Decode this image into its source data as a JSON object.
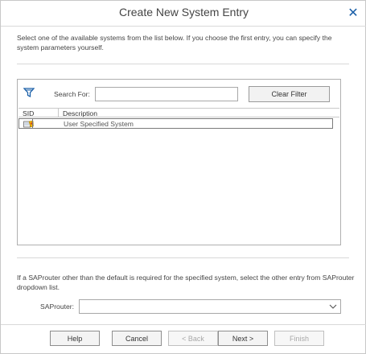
{
  "dialog": {
    "title": "Create New System Entry",
    "close_glyph": "✕"
  },
  "intro": {
    "text": "Select one of the available systems from the list below. If you choose the first entry, you can specify the system parameters yourself."
  },
  "filter": {
    "icon": "filter-icon",
    "search_label": "Search For:",
    "search_value": "",
    "clear_label": "Clear Filter"
  },
  "grid": {
    "columns": [
      "SID",
      "Description"
    ],
    "rows": [
      {
        "sid": "",
        "icon": "user-specified-system-icon",
        "description": "User Specified System"
      }
    ]
  },
  "router": {
    "note": "If a SAProuter other than the default is required for the specified system, select the other entry from SAProuter dropdown list.",
    "label": "SAProuter:",
    "value": ""
  },
  "buttons": {
    "help": "Help",
    "cancel": "Cancel",
    "back": "< Back",
    "next": "Next >",
    "finish": "Finish"
  },
  "colors": {
    "close_icon": "#1a5fa8",
    "filter_icon": "#1a5fa8",
    "disabled_text": "#a8a8a8"
  }
}
